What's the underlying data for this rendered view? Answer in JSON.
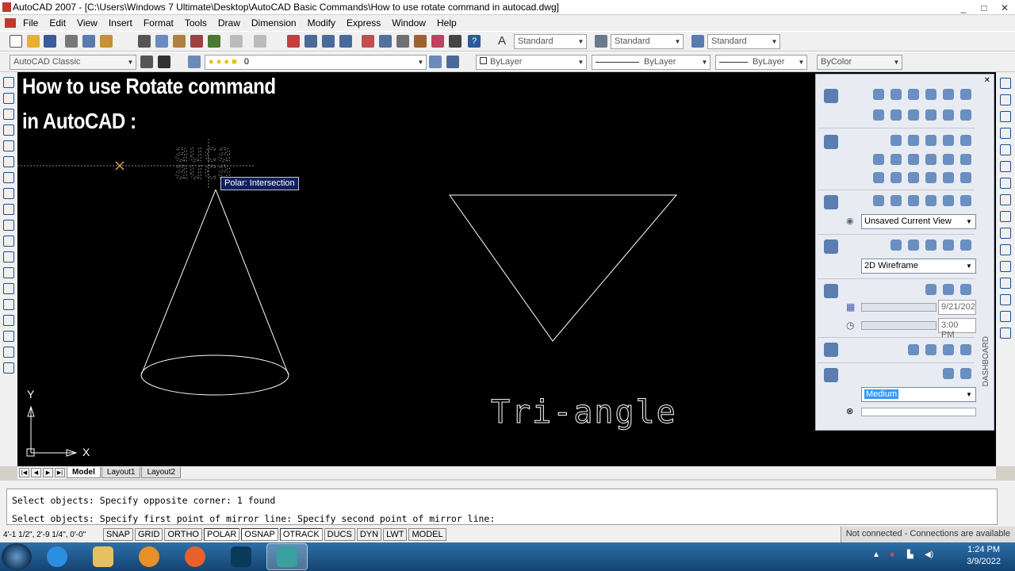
{
  "window": {
    "title": "AutoCAD 2007 - [C:\\Users\\Windows 7 Ultimate\\Desktop\\AutoCAD Basic Commands\\How to use rotate command in autocad.dwg]",
    "controls": [
      "_",
      "□",
      "✕"
    ]
  },
  "menu": [
    "File",
    "Edit",
    "View",
    "Insert",
    "Format",
    "Tools",
    "Draw",
    "Dimension",
    "Modify",
    "Express",
    "Window",
    "Help"
  ],
  "toolbar1": {
    "text_style": "Standard",
    "dim_style": "Standard",
    "table_style": "Standard"
  },
  "toolbar2": {
    "workspace": "AutoCAD Classic",
    "layer": "0",
    "color": "ByLayer",
    "linetype": "ByLayer",
    "lineweight": "ByLayer",
    "plotstyle": "ByColor"
  },
  "overlay": {
    "line1": "How to use Rotate command",
    "line2": "in AutoCAD :"
  },
  "tooltip": "Polar: Intersection",
  "drawing": {
    "label": "Tri-angle",
    "ucs_x": "X",
    "ucs_y": "Y"
  },
  "dashboard": {
    "title": "DASHBOARD",
    "view": "Unsaved Current View",
    "visual_style": "2D Wireframe",
    "date": "9/21/202",
    "time": "3:00 PM",
    "quality": "Medium"
  },
  "tabs": [
    "Model",
    "Layout1",
    "Layout2"
  ],
  "command": {
    "line1": "Select objects: Specify opposite corner: 1 found",
    "line2": "Select objects:  Specify first point of mirror line: Specify second point of mirror line:"
  },
  "status": {
    "coords": "4'-1 1/2\", 2'-9 1/4\", 0'-0\"",
    "buttons": [
      "SNAP",
      "GRID",
      "ORTHO",
      "POLAR",
      "OSNAP",
      "OTRACK",
      "DUCS",
      "DYN",
      "LWT",
      "MODEL"
    ],
    "connection": "Not connected - Connections are available"
  },
  "taskbar": {
    "time": "1:24 PM",
    "date": "3/9/2022"
  },
  "colors": {
    "canvas": "#000000",
    "tooltip_bg": "#102060",
    "taskbar": "#1d5a8f",
    "selected": "#3399ff"
  }
}
